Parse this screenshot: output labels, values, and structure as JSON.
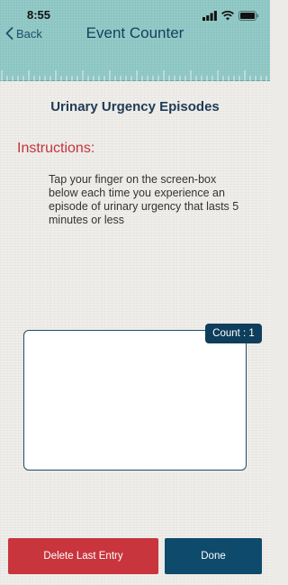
{
  "status_bar": {
    "time": "8:55"
  },
  "nav": {
    "back_label": "Back",
    "title": "Event Counter"
  },
  "page": {
    "title": "Urinary Urgency Episodes",
    "instructions_heading": "Instructions:",
    "instructions_text": "Tap your finger on the screen-box below each time you experience an episode of urinary urgency that lasts 5 minutes or less"
  },
  "counter": {
    "badge_label": "Count : 1"
  },
  "actions": {
    "delete_label": "Delete Last Entry",
    "done_label": "Done"
  },
  "colors": {
    "header_teal": "#8fc8c5",
    "navy": "#0e4a6b",
    "instructions_red": "#c4343d",
    "delete_red": "#c8353d"
  },
  "icons": [
    "signal-icon",
    "wifi-icon",
    "battery-icon",
    "chevron-left-icon",
    "ruler-graphic"
  ]
}
